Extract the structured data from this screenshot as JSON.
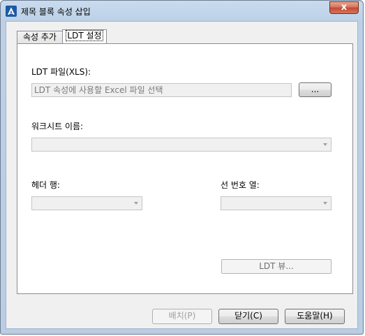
{
  "window": {
    "title": "제목 블록 속성 삽입",
    "close_glyph": "x"
  },
  "tabs": [
    {
      "label": "속성 추가",
      "active": false
    },
    {
      "label": "LDT 설정",
      "active": true
    }
  ],
  "ldt_file": {
    "label": "LDT 파일(XLS):",
    "placeholder": "LDT 속성에 사용할 Excel 파일 선택",
    "browse_label": "..."
  },
  "worksheet": {
    "label": "워크시트 이름:",
    "value": ""
  },
  "header_row": {
    "label": "헤더 행:",
    "value": ""
  },
  "line_number_column": {
    "label": "선 번호 열:",
    "value": ""
  },
  "ldt_view_button": "LDT 뷰...",
  "footer": {
    "place_button": "배치(P)",
    "close_button": "닫기(C)",
    "help_button": "도움말(H)"
  },
  "colors": {
    "title_gradient_top": "#c9dbee",
    "close_red": "#c04a32",
    "client_bg": "#f0f0f0"
  }
}
